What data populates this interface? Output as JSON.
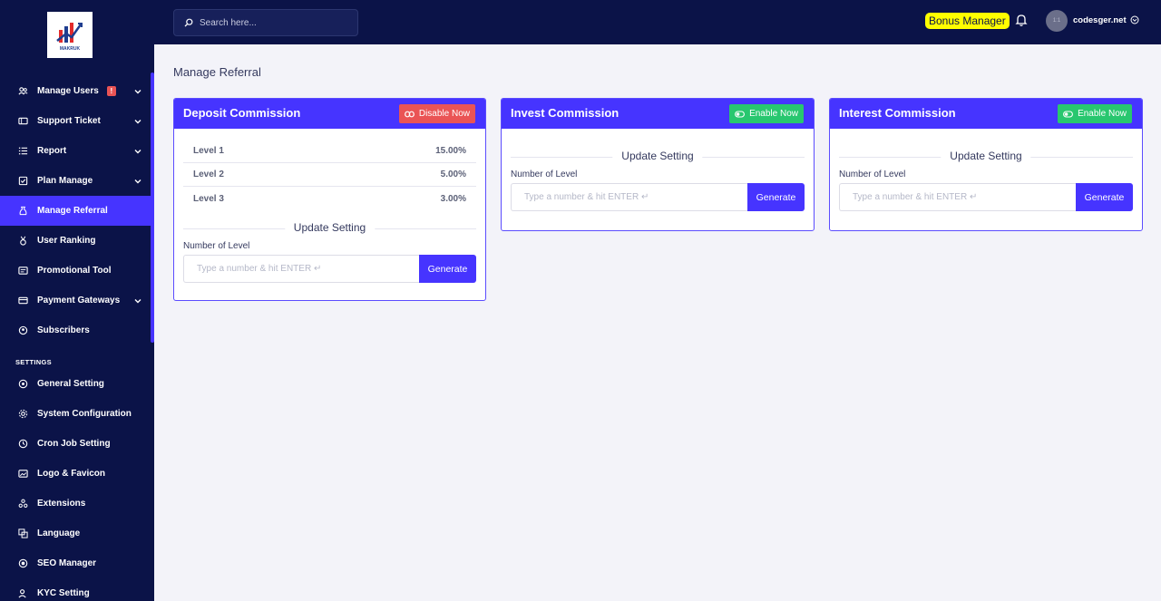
{
  "sidebar": {
    "logo_text": "MAKRUK",
    "items": [
      {
        "label": "Manage Users",
        "icon": "users-icon",
        "badge": "!",
        "caret": true
      },
      {
        "label": "Support Ticket",
        "icon": "ticket-icon",
        "caret": true
      },
      {
        "label": "Report",
        "icon": "list-icon",
        "caret": true
      },
      {
        "label": "Plan Manage",
        "icon": "checkbox-icon",
        "caret": true
      },
      {
        "label": "Manage Referral",
        "icon": "referral-icon",
        "active": true
      },
      {
        "label": "User Ranking",
        "icon": "medal-icon"
      },
      {
        "label": "Promotional Tool",
        "icon": "promo-icon"
      },
      {
        "label": "Payment Gateways",
        "icon": "credit-card-icon",
        "caret": true
      },
      {
        "label": "Subscribers",
        "icon": "subscribers-icon"
      }
    ],
    "settings_heading": "SETTINGS",
    "settings_items": [
      {
        "label": "General Setting",
        "icon": "globe-icon"
      },
      {
        "label": "System Configuration",
        "icon": "gear-icon"
      },
      {
        "label": "Cron Job Setting",
        "icon": "clock-icon"
      },
      {
        "label": "Logo & Favicon",
        "icon": "image-icon"
      },
      {
        "label": "Extensions",
        "icon": "extensions-icon"
      },
      {
        "label": "Language",
        "icon": "language-icon"
      },
      {
        "label": "SEO Manager",
        "icon": "seo-icon"
      },
      {
        "label": "KYC Setting",
        "icon": "kyc-icon"
      }
    ]
  },
  "topbar": {
    "search_placeholder": "Search here...",
    "bonus_label": "Bonus Manager",
    "avatar_text": "1:1",
    "username": "codesger.net"
  },
  "page": {
    "title": "Manage Referral"
  },
  "cards": {
    "deposit": {
      "title": "Deposit Commission",
      "status_button": "Disable Now",
      "levels": [
        {
          "name": "Level 1",
          "value": "15.00%"
        },
        {
          "name": "Level 2",
          "value": "5.00%"
        },
        {
          "name": "Level 3",
          "value": "3.00%"
        }
      ],
      "update_heading": "Update Setting",
      "level_label": "Number of Level",
      "input_placeholder": "Type a number & hit ENTER ↵",
      "generate_label": "Generate"
    },
    "invest": {
      "title": "Invest Commission",
      "status_button": "Enable Now",
      "update_heading": "Update Setting",
      "level_label": "Number of Level",
      "input_placeholder": "Type a number & hit ENTER ↵",
      "generate_label": "Generate"
    },
    "interest": {
      "title": "Interest Commission",
      "status_button": "Enable Now",
      "update_heading": "Update Setting",
      "level_label": "Number of Level",
      "input_placeholder": "Type a number & hit ENTER ↵",
      "generate_label": "Generate"
    }
  },
  "colors": {
    "sidebar_bg": "#0b1348",
    "primary": "#4634ff",
    "danger": "#ea5455",
    "success": "#28c76f",
    "highlight": "#ffff00",
    "content_bg": "#f3f3f9"
  }
}
